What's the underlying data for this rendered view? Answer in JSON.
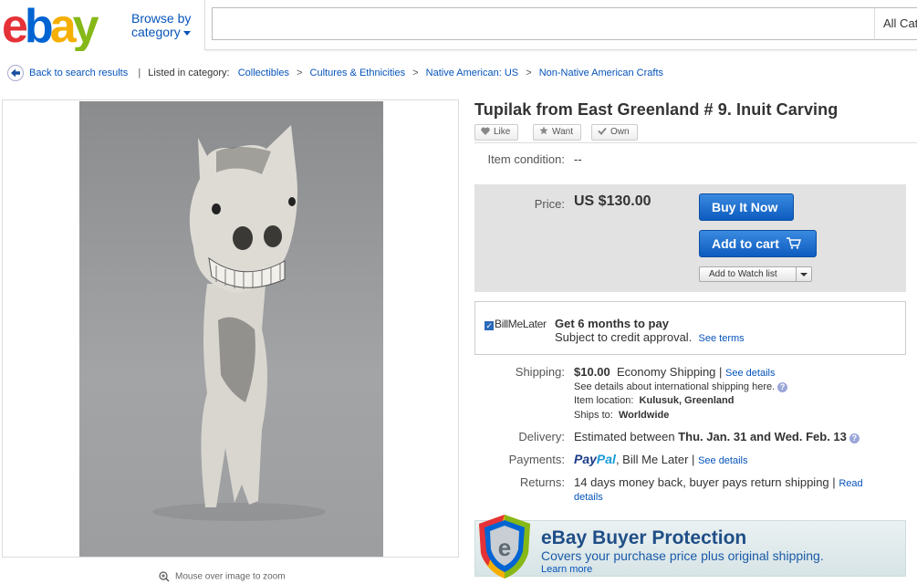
{
  "header": {
    "logo_text": "ebay",
    "browse_line1": "Browse by",
    "browse_line2": "category",
    "search_value": "",
    "category_select": "All Cat"
  },
  "breadcrumb": {
    "back": "Back to search results",
    "listed": "Listed in category:",
    "items": [
      "Collectibles",
      "Cultures & Ethnicities",
      "Native American: US",
      "Non-Native American Crafts"
    ],
    "sep": ">"
  },
  "item": {
    "title": "Tupilak from East Greenland # 9. Inuit Carving",
    "social": [
      "Like",
      "Want",
      "Own"
    ],
    "condition_label": "Item condition:",
    "condition_value": "--",
    "price_label": "Price:",
    "price": "US $130.00",
    "buy_now": "Buy It Now",
    "add_to_cart": "Add to cart",
    "watch": "Add to Watch list"
  },
  "bml": {
    "logo": "BillMeLater",
    "headline": "Get 6 months to pay",
    "sub": "Subject to credit approval.",
    "see_terms": "See terms"
  },
  "shipping": {
    "label": "Shipping:",
    "cost": "$10.00",
    "service": "Economy Shipping",
    "pipe": "|",
    "see_details": "See details",
    "intl": "See details about international shipping here.",
    "location_label": "Item location:",
    "location": "Kulusuk, Greenland",
    "ships_label": "Ships to:",
    "ships_to": "Worldwide"
  },
  "delivery": {
    "label": "Delivery:",
    "prefix": "Estimated between",
    "dates": "Thu. Jan. 31 and Wed. Feb. 13"
  },
  "payments": {
    "label": "Payments:",
    "paypal_a": "Pay",
    "paypal_b": "Pal",
    "rest": ", Bill Me Later",
    "pipe": "|",
    "see_details": "See details"
  },
  "returns": {
    "label": "Returns:",
    "text": "14 days money back, buyer pays return shipping",
    "pipe": "|",
    "link1": "Read",
    "link2": "details"
  },
  "protection": {
    "title": "eBay Buyer Protection",
    "sub": "Covers your purchase price plus original shipping.",
    "link": "Learn more"
  },
  "image": {
    "zoom_hint": "Mouse over image to zoom"
  }
}
